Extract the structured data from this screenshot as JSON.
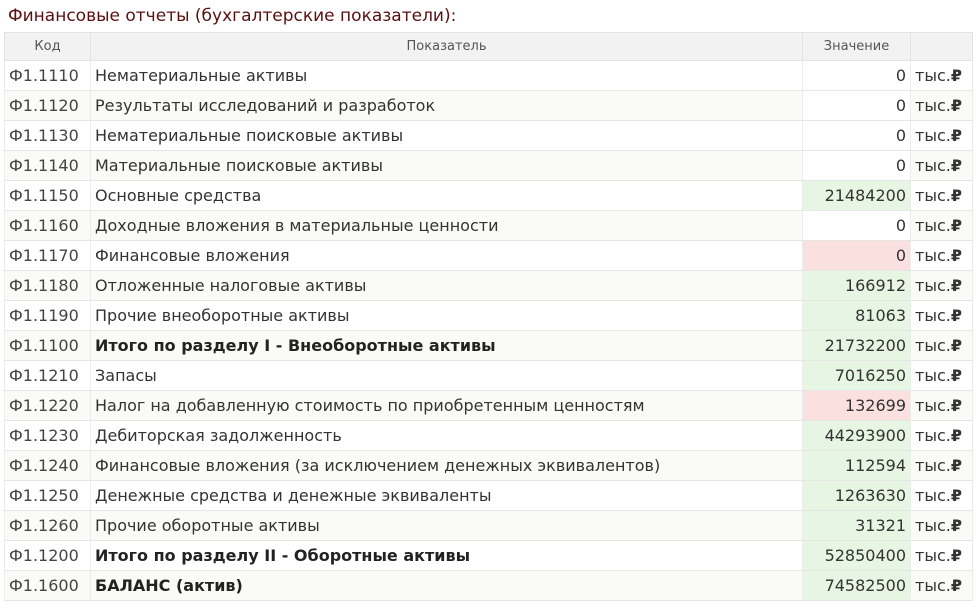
{
  "header": {
    "title": "Финансовые отчеты (бухгалтерские показатели):"
  },
  "columns": {
    "code": "Код",
    "name": "Показатель",
    "value": "Значение",
    "unit": ""
  },
  "unit_text": "тыс.",
  "currency_symbol": "₽",
  "highlight_colors": {
    "green": "#e6f6e2",
    "red": "#fbe0e0"
  },
  "rows": [
    {
      "code": "Ф1.1110",
      "name": "Нематериальные активы",
      "value": "0",
      "hl": "plain",
      "bold": false
    },
    {
      "code": "Ф1.1120",
      "name": "Результаты исследований и разработок",
      "value": "0",
      "hl": "plain",
      "bold": false
    },
    {
      "code": "Ф1.1130",
      "name": "Нематериальные поисковые активы",
      "value": "0",
      "hl": "plain",
      "bold": false
    },
    {
      "code": "Ф1.1140",
      "name": "Материальные поисковые активы",
      "value": "0",
      "hl": "plain",
      "bold": false
    },
    {
      "code": "Ф1.1150",
      "name": "Основные средства",
      "value": "21484200",
      "hl": "green",
      "bold": false
    },
    {
      "code": "Ф1.1160",
      "name": "Доходные вложения в материальные ценности",
      "value": "0",
      "hl": "plain",
      "bold": false
    },
    {
      "code": "Ф1.1170",
      "name": "Финансовые вложения",
      "value": "0",
      "hl": "red",
      "bold": false
    },
    {
      "code": "Ф1.1180",
      "name": "Отложенные налоговые активы",
      "value": "166912",
      "hl": "green",
      "bold": false
    },
    {
      "code": "Ф1.1190",
      "name": "Прочие внеоборотные активы",
      "value": "81063",
      "hl": "green",
      "bold": false
    },
    {
      "code": "Ф1.1100",
      "name": "Итого по разделу I - Внеоборотные активы",
      "value": "21732200",
      "hl": "green",
      "bold": true
    },
    {
      "code": "Ф1.1210",
      "name": "Запасы",
      "value": "7016250",
      "hl": "green",
      "bold": false
    },
    {
      "code": "Ф1.1220",
      "name": "Налог на добавленную стоимость по приобретенным ценностям",
      "value": "132699",
      "hl": "red",
      "bold": false
    },
    {
      "code": "Ф1.1230",
      "name": "Дебиторская задолженность",
      "value": "44293900",
      "hl": "green",
      "bold": false
    },
    {
      "code": "Ф1.1240",
      "name": "Финансовые вложения (за исключением денежных эквивалентов)",
      "value": "112594",
      "hl": "green",
      "bold": false
    },
    {
      "code": "Ф1.1250",
      "name": "Денежные средства и денежные эквиваленты",
      "value": "1263630",
      "hl": "green",
      "bold": false
    },
    {
      "code": "Ф1.1260",
      "name": "Прочие оборотные активы",
      "value": "31321",
      "hl": "green",
      "bold": false
    },
    {
      "code": "Ф1.1200",
      "name": "Итого по разделу II - Оборотные активы",
      "value": "52850400",
      "hl": "green",
      "bold": true
    },
    {
      "code": "Ф1.1600",
      "name": "БАЛАНС (актив)",
      "value": "74582500",
      "hl": "green",
      "bold": true
    }
  ]
}
